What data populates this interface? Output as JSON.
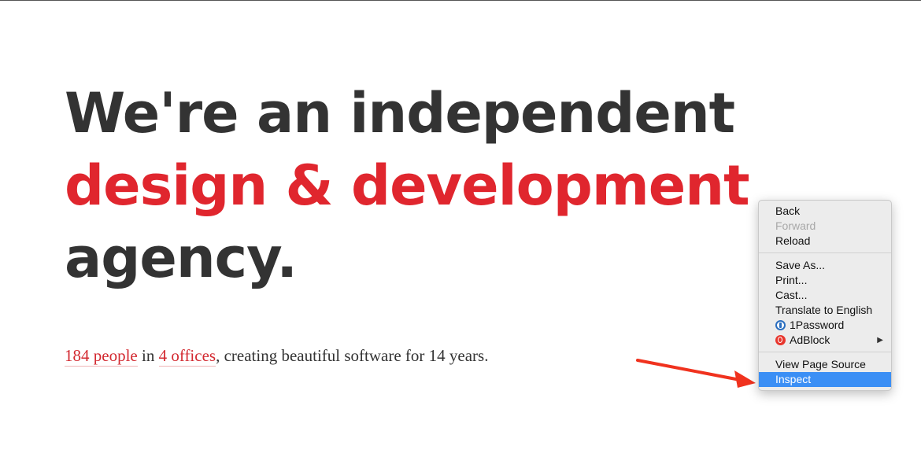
{
  "hero": {
    "line1": "We're an independent",
    "line2": "design & development",
    "line3": "agency."
  },
  "tagline": {
    "people_link": "184 people",
    "in_text": " in ",
    "offices_link": "4 offices",
    "rest": ", creating beautiful software for 14 years."
  },
  "colors": {
    "accent": "#e0262e",
    "text": "#333333",
    "menu_highlight": "#3b8ff5",
    "annotation_arrow": "#f0321e"
  },
  "context_menu": {
    "back": "Back",
    "forward": "Forward",
    "reload": "Reload",
    "save_as": "Save As...",
    "print": "Print...",
    "cast": "Cast...",
    "translate": "Translate to English",
    "onepassword": "1Password",
    "onepassword_icon": "1password-icon",
    "adblock": "AdBlock",
    "adblock_icon": "adblock-icon",
    "submenu_arrow": "▶",
    "view_source": "View Page Source",
    "inspect": "Inspect"
  }
}
